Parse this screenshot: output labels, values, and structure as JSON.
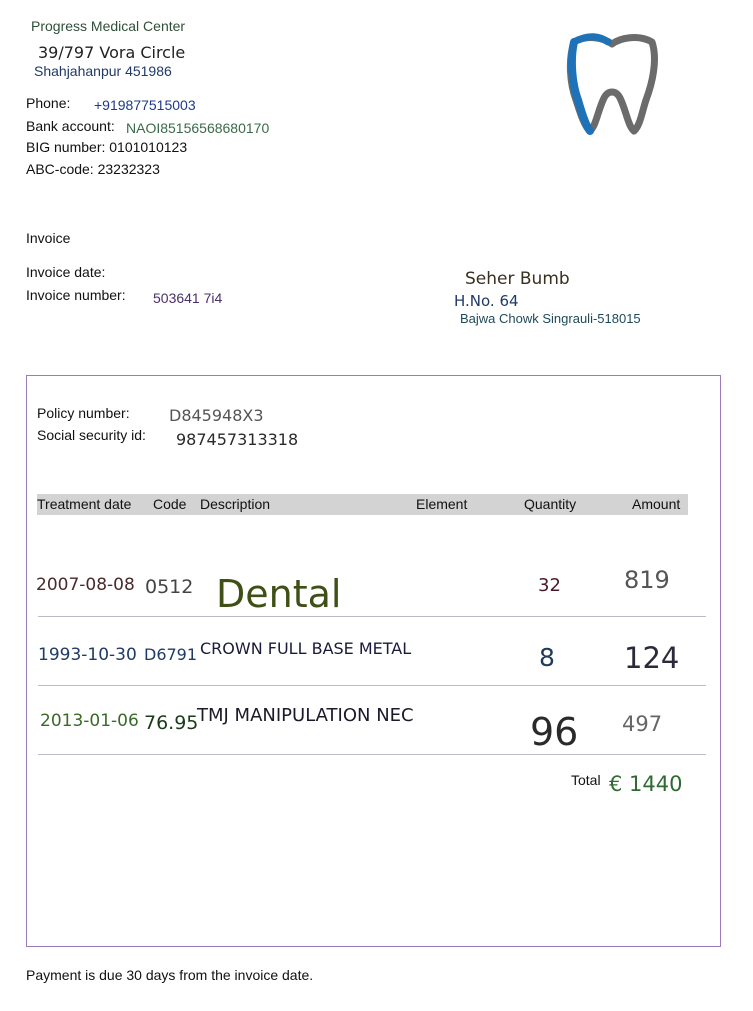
{
  "clinic": {
    "name": "Progress Medical Center",
    "street": "39/797 Vora Circle",
    "city": "Shahjahanpur 451986",
    "phone_label": "Phone:",
    "phone": "+919877515003",
    "bank_label": "Bank account:",
    "bank": "NAOI85156568680170",
    "big_line": "BIG number: 0101010123",
    "abc_line": "ABC-code: 23232323"
  },
  "logo": {
    "icon": "tooth-icon",
    "colors": [
      "#1e73b8",
      "#6b6b6b"
    ]
  },
  "invoice": {
    "title": "Invoice",
    "date_label": "Invoice date:",
    "date": "",
    "number_label": "Invoice number:",
    "number": "503641 7i4"
  },
  "recipient": {
    "name": "Seher Bumb",
    "address1": "H.No. 64",
    "address2": "Bajwa Chowk Singrauli-518015"
  },
  "policy": {
    "policy_label": "Policy number:",
    "policy": "D845948X3",
    "ssn_label": "Social security id:",
    "ssn": "987457313318"
  },
  "table": {
    "headers": [
      "Treatment date",
      "Code",
      "Description",
      "Element",
      "Quantity",
      "Amount"
    ],
    "rows": [
      {
        "date": "2007-08-08",
        "code": "0512",
        "description": "Dental",
        "element": "",
        "quantity": "32",
        "amount": "819"
      },
      {
        "date": "1993-10-30",
        "code": "D6791",
        "description": "CROWN FULL BASE METAL",
        "element": "",
        "quantity": "8",
        "amount": "124"
      },
      {
        "date": "2013-01-06",
        "code": "76.95",
        "description": "TMJ MANIPULATION NEC",
        "element": "",
        "quantity": "96",
        "amount": "497"
      }
    ],
    "total_label": "Total",
    "total": "€ 1440"
  },
  "footer": {
    "note": "Payment is due 30 days from the invoice date."
  }
}
